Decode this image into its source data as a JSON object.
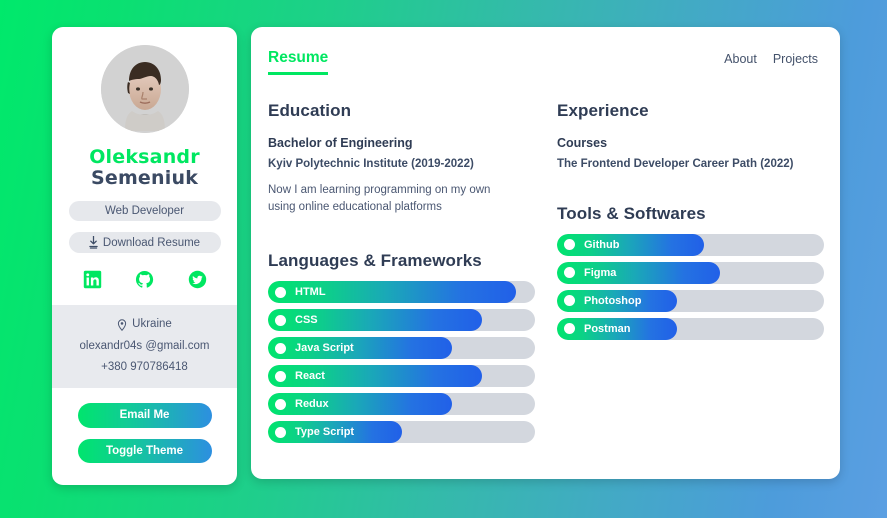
{
  "theme": {
    "bg_gradient_start": "#00e96b",
    "bg_gradient_end": "#5b9fe2",
    "accent_green": "#00e761",
    "accent_blue": "#2160e8",
    "text_dark": "#2f3c54",
    "track_gray": "#d3d7de"
  },
  "sidebar": {
    "avatar_alt": "avatar-photo",
    "name_first": "Oleksandr",
    "name_last": "Semeniuk",
    "role_label": "Web Developer",
    "download_label": "Download Resume",
    "socials": [
      {
        "name": "linkedin",
        "icon": "linkedin-icon"
      },
      {
        "name": "github",
        "icon": "github-icon"
      },
      {
        "name": "twitter",
        "icon": "twitter-icon"
      }
    ],
    "contact": {
      "location_icon": "location-pin-icon",
      "location": "Ukraine",
      "email": "olexandr04s @gmail.com",
      "phone": "+380 970786418"
    },
    "email_button": "Email Me",
    "theme_button": "Toggle Theme"
  },
  "main": {
    "active_tab": "Resume",
    "nav_links": [
      "About",
      "Projects"
    ],
    "education": {
      "title": "Education",
      "degree": "Bachelor of Engineering",
      "school": "Kyiv Polytechnic Institute (2019-2022)",
      "note": "Now I am learning programming on my own using online educational platforms"
    },
    "experience": {
      "title": "Experience",
      "subtitle": "Courses",
      "course": "The Frontend Developer Career Path (2022)"
    },
    "languages": {
      "title": "Languages & Frameworks",
      "items": [
        {
          "label": "HTML",
          "percent": 93
        },
        {
          "label": "CSS",
          "percent": 80
        },
        {
          "label": "Java Script",
          "percent": 69
        },
        {
          "label": "React",
          "percent": 80
        },
        {
          "label": "Redux",
          "percent": 69
        },
        {
          "label": "Type Script",
          "percent": 50
        }
      ]
    },
    "tools": {
      "title": "Tools & Softwares",
      "items": [
        {
          "label": "Github",
          "percent": 55
        },
        {
          "label": "Figma",
          "percent": 61
        },
        {
          "label": "Photoshop",
          "percent": 45
        },
        {
          "label": "Postman",
          "percent": 45
        }
      ]
    }
  }
}
